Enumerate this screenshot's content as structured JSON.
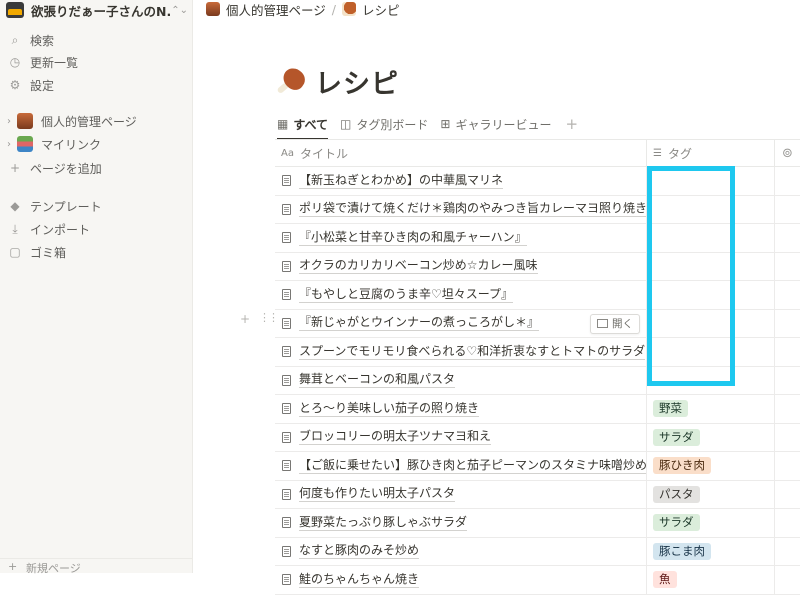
{
  "sidebar": {
    "workspace_name": "欲張りだぁー子さんのN...",
    "workspace_chevron": "⌃",
    "search": "検索",
    "updates": "更新一覧",
    "settings": "設定",
    "pages": [
      {
        "label": "個人的管理ページ"
      },
      {
        "label": "マイリンク"
      }
    ],
    "add_page": "ページを追加",
    "templates": "テンプレート",
    "import": "インポート",
    "trash": "ゴミ箱",
    "new_page": "新規ページ"
  },
  "breadcrumb": {
    "parent": "個人的管理ページ",
    "separator": "/",
    "current": "レシピ"
  },
  "page": {
    "title": "レシピ"
  },
  "tabs": [
    {
      "label": "すべて",
      "icon": "table-icon"
    },
    {
      "label": "タグ別ボード",
      "icon": "board-icon"
    },
    {
      "label": "ギャラリービュー",
      "icon": "gallery-icon"
    }
  ],
  "table": {
    "headers": {
      "title": "タイトル",
      "title_prefix": "Aa",
      "tag": "タグ"
    },
    "open_label": "開く",
    "rows": [
      {
        "title": "【新玉ねぎとわかめ】の中華風マリネ",
        "tag": ""
      },
      {
        "title": "ポリ袋で漬けて焼くだけ＊鶏肉のやみつき旨カレーマヨ照り焼き＊",
        "tag": ""
      },
      {
        "title": "『小松菜と甘辛ひき肉の和風チャーハン』",
        "tag": ""
      },
      {
        "title": "オクラのカリカリベーコン炒め☆カレー風味",
        "tag": ""
      },
      {
        "title": "『もやしと豆腐のうま辛♡坦々スープ』",
        "tag": ""
      },
      {
        "title": "『新じゃがとウインナーの煮っころがし＊』",
        "tag": ""
      },
      {
        "title": "スプーンでモリモリ食べられる♡和洋折衷なすとトマトのサラダ",
        "tag": ""
      },
      {
        "title": "舞茸とベーコンの和風パスタ",
        "tag": ""
      },
      {
        "title": "とろ〜り美味しい茄子の照り焼き",
        "tag": "野菜"
      },
      {
        "title": "ブロッコリーの明太子ツナマヨ和え",
        "tag": "サラダ"
      },
      {
        "title": "【ご飯に乗せたい】豚ひき肉と茄子ピーマンのスタミナ味噌炒め",
        "tag": "豚ひき肉"
      },
      {
        "title": "何度も作りたい明太子パスタ",
        "tag": "パスタ"
      },
      {
        "title": "夏野菜たっぷり豚しゃぶサラダ",
        "tag": "サラダ"
      },
      {
        "title": "なすと豚肉のみそ炒め",
        "tag": "豚こま肉"
      },
      {
        "title": "鮭のちゃんちゃん焼き",
        "tag": "魚"
      }
    ]
  },
  "tag_colors": {
    "野菜": {
      "bg": "#dbeddb",
      "fg": "#1c3829"
    },
    "サラダ": {
      "bg": "#dbeddb",
      "fg": "#1c3829"
    },
    "豚ひき肉": {
      "bg": "#fadec9",
      "fg": "#49290e"
    },
    "パスタ": {
      "bg": "#e3e2e0",
      "fg": "#32302c"
    },
    "豚こま肉": {
      "bg": "#d3e5ef",
      "fg": "#183347"
    },
    "魚": {
      "bg": "#ffe2dd",
      "fg": "#5d1715"
    }
  },
  "highlight_color": "#1ec8ef"
}
